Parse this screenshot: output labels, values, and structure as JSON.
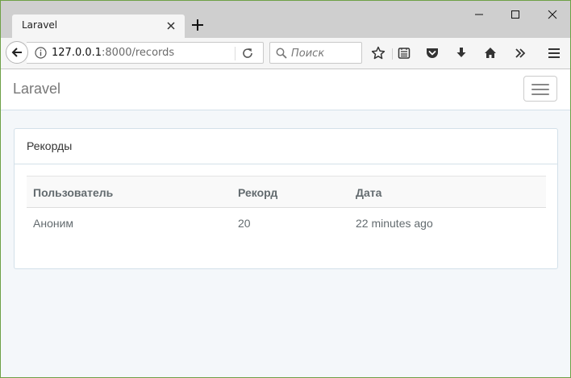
{
  "browser": {
    "tab_title": "Laravel",
    "url_host": "127.0.0.1",
    "url_path": ":8000/records",
    "search_placeholder": "Поиск"
  },
  "app": {
    "brand": "Laravel"
  },
  "records": {
    "panel_title": "Рекорды",
    "columns": [
      "Пользователь",
      "Рекорд",
      "Дата"
    ],
    "rows": [
      {
        "user": "Аноним",
        "score": "20",
        "date": "22 minutes ago"
      }
    ]
  }
}
